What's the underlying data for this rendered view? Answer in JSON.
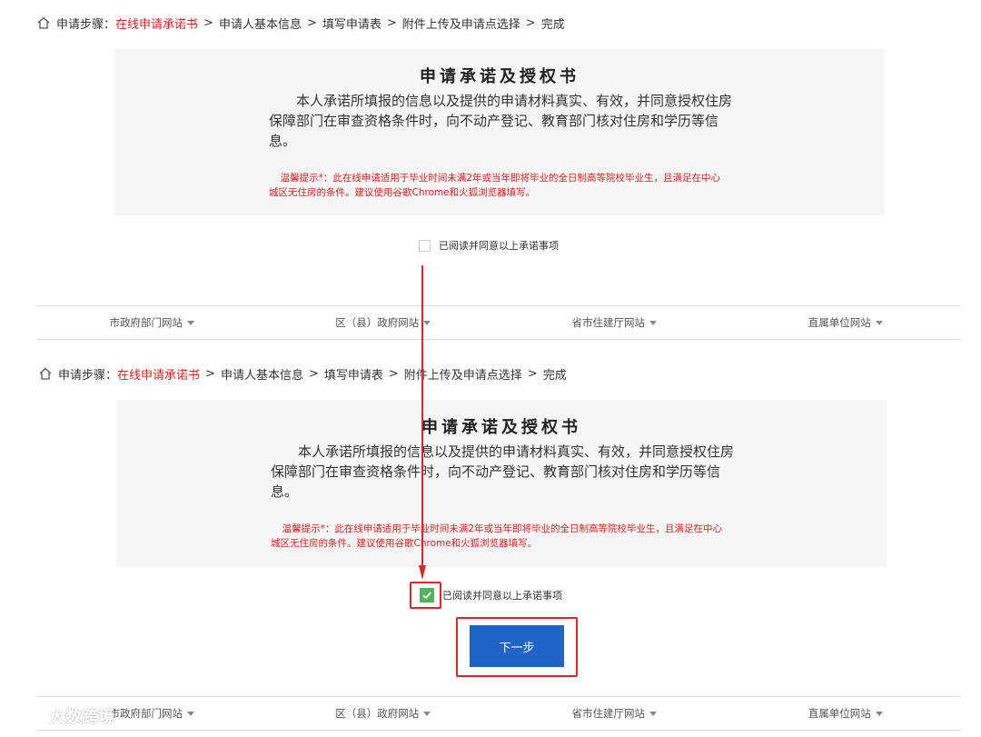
{
  "breadcrumb": {
    "prefix": "申请步骤：",
    "steps": [
      "在线申请承诺书",
      "申请人基本信息",
      "填写申请表",
      "附件上传及申请点选择",
      "完成"
    ],
    "separator": ">"
  },
  "card": {
    "title": "申请承诺及授权书",
    "body": "本人承诺所填报的信息以及提供的申请材料真实、有效，并同意授权住房保障部门在审查资格条件时，向不动产登记、教育部门核对住房和学历等信息。",
    "hint": "温馨提示*：此在线申请适用于毕业时间未满2年或当年即将毕业的全日制高等院校毕业生，且满足在中心城区无住房的条件。建议使用谷歌Chrome和火狐浏览器填写。"
  },
  "agree": {
    "label": "已阅读并同意以上承诺事项",
    "checked_before": false,
    "checked_after": true
  },
  "next_button": {
    "label": "下一步"
  },
  "footer_nav": [
    {
      "label": "市政府部门网站"
    },
    {
      "label": "区（县）政府网站"
    },
    {
      "label": "省市住建厅网站"
    },
    {
      "label": "直属单位网站"
    }
  ],
  "watermark": {
    "text": "大数跨境"
  },
  "colors": {
    "accent_red": "#e02020",
    "button_blue": "#1f63c6",
    "checkbox_green": "#52b35c",
    "card_bg": "#f6f6f6",
    "annotation_red": "#d92828"
  }
}
